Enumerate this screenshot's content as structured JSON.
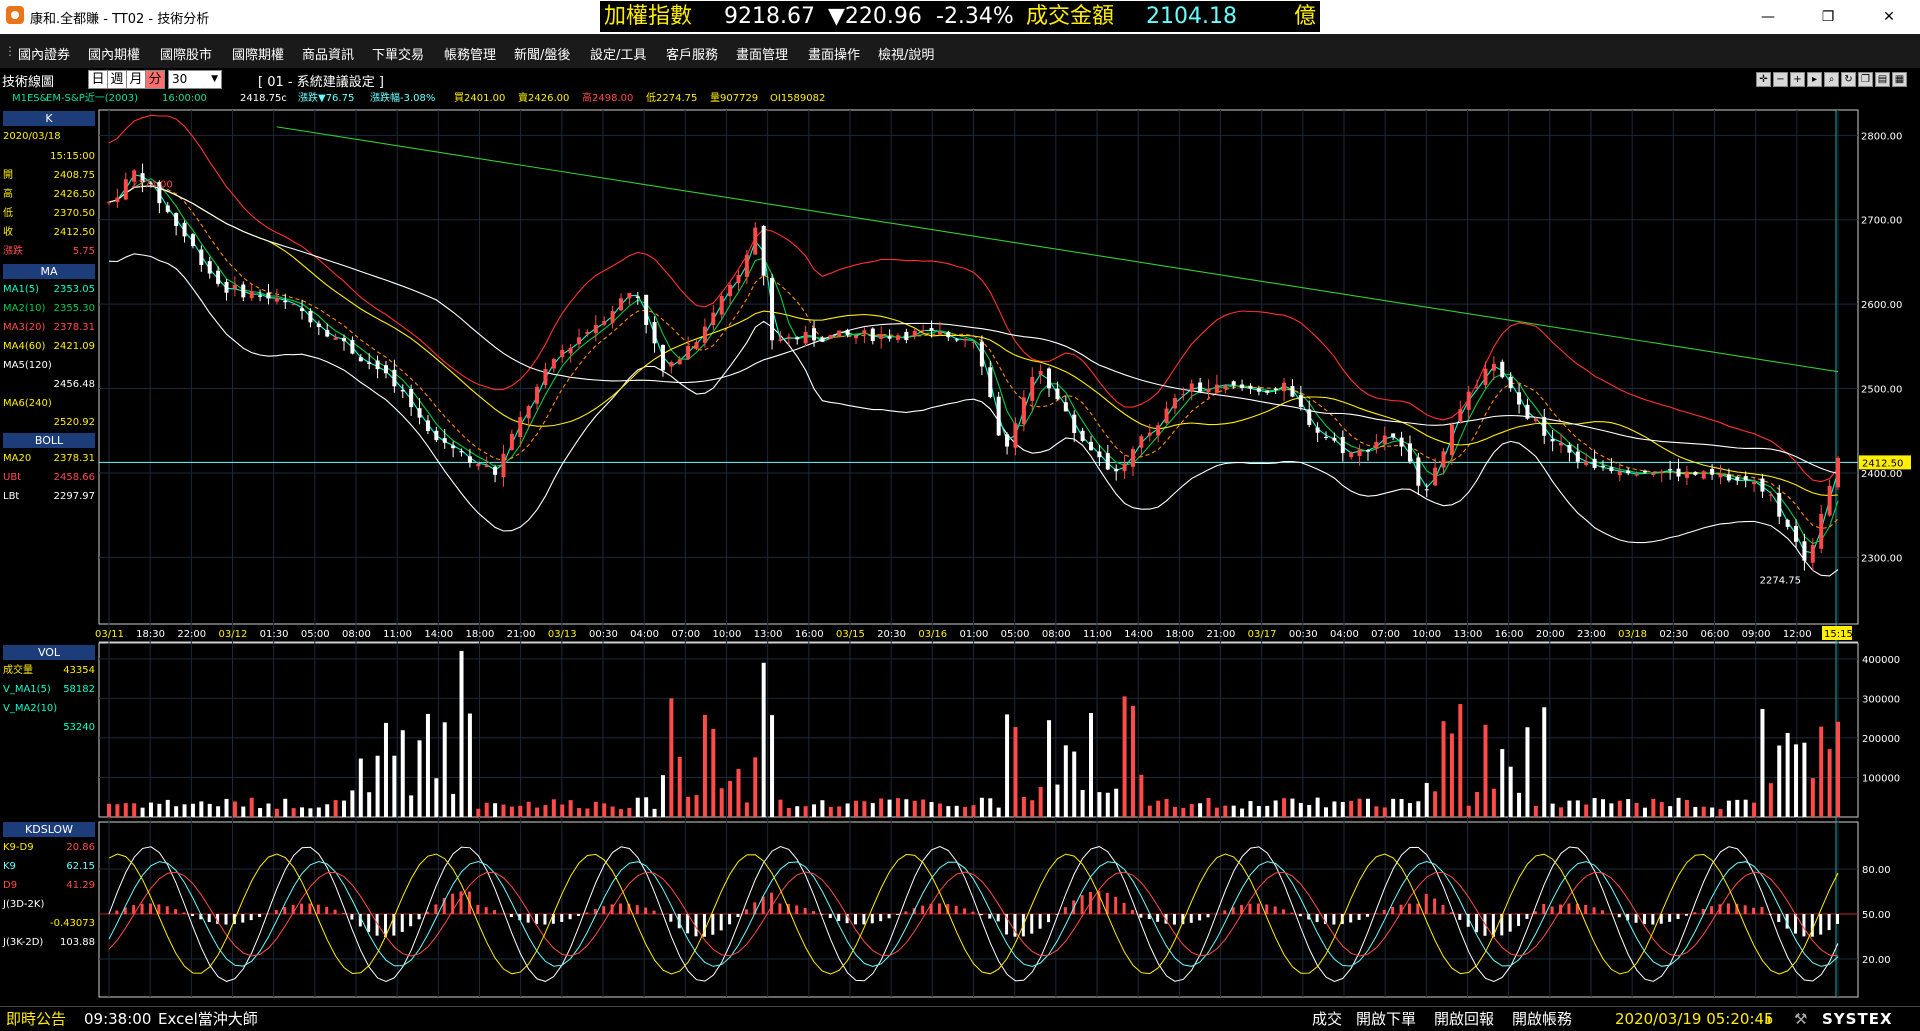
{
  "window": {
    "title": "康和.全都賺 - TT02 - 技術分析",
    "minimize_glyph": "—",
    "maximize_glyph": "❐",
    "close_glyph": "✕"
  },
  "ticker": {
    "index_label": "加權指數",
    "index_value": "9218.67",
    "change": "▼220.96",
    "change_pct": "-2.34%",
    "turnover_label": "成交金額",
    "turnover_value": "2104.18",
    "turnover_unit": "億"
  },
  "menu": {
    "items": [
      "國內證券",
      "國內期權",
      "國際股市",
      "國際期權",
      "商品資訊",
      "下單交易",
      "帳務管理",
      "新聞/盤後",
      "設定/工具",
      "客戶服務",
      "畫面管理",
      "畫面操作",
      "檢視/說明"
    ]
  },
  "toolbar": {
    "title": "技術線圖",
    "periods": [
      "日",
      "週",
      "月",
      "分"
    ],
    "selected_period": "分",
    "interval_value": "30",
    "system_setting": "[ 01 - 系統建議設定 ]"
  },
  "info": {
    "symbol": "M1ES&",
    "name": "EM-S&P近一(2003)",
    "time": "16:00:00",
    "price": "2418.75c",
    "change": "漲跌▼76.75",
    "change_pct": "漲跌幅-3.08%",
    "buy": "買2401.00",
    "sell": "賣2426.00",
    "high": "高2498.00",
    "low": "低2274.75",
    "volume": "量907729",
    "oi": "OI1589082"
  },
  "sidebar": {
    "k_head": "K",
    "date": "2020/03/18",
    "time": "15:15:00",
    "open_label": "開",
    "open_value": "2408.75",
    "high_label": "高",
    "high_value": "2426.50",
    "low_label": "低",
    "low_value": "2370.50",
    "close_label": "收",
    "close_value": "2412.50",
    "chg_label": "漲跌",
    "chg_value": "5.75",
    "ma_head": "MA",
    "ma1_label": "MA1(5)",
    "ma1_value": "2353.05",
    "ma2_label": "MA2(10)",
    "ma2_value": "2355.30",
    "ma3_label": "MA3(20)",
    "ma3_value": "2378.31",
    "ma4_label": "MA4(60)",
    "ma4_value": "2421.09",
    "ma5_label": "MA5(120)",
    "ma5_value": "2456.48",
    "ma6_label": "MA6(240)",
    "ma6_value": "2520.92",
    "boll_head": "BOLL",
    "bma_label": "MA20",
    "bma_value": "2378.31",
    "ubt_label": "UBt",
    "ubt_value": "2458.66",
    "lbt_label": "LBt",
    "lbt_value": "2297.97",
    "vol_head": "VOL",
    "vol_label": "成交量",
    "vol_value": "43354",
    "vma1_label": "V_MA1(5)",
    "vma1_value": "58182",
    "vma2_label": "V_MA2(10)",
    "vma2_value": "53240",
    "kd_head": "KDSLOW",
    "k9d9_label": "K9-D9",
    "k9d9_value": "20.86",
    "k9_label": "K9",
    "k9_value": "62.15",
    "d9_label": "D9",
    "d9_value": "41.29",
    "j3d_label": "J(3D-2K)",
    "j3d_value": "-0.43073",
    "j3k_label": "J(3K-2D)",
    "j3k_value": "103.88"
  },
  "axes": {
    "price_ticks": [
      "2800.00",
      "2700.00",
      "2600.00",
      "2500.00",
      "2400.00",
      "2300.00"
    ],
    "price_ticks_values": [
      2800,
      2700,
      2600,
      2500,
      2400,
      2300
    ],
    "price_marker": "2412.50",
    "high_label": "2774.00",
    "low_label": "2274.75",
    "vol_ticks": [
      "400000",
      "300000",
      "200000",
      "100000"
    ],
    "vol_ticks_values": [
      400000,
      300000,
      200000,
      100000
    ],
    "kd_ticks": [
      "80.00",
      "50.00",
      "20.00"
    ],
    "kd_ticks_values": [
      80,
      50,
      20
    ],
    "time_labels": [
      {
        "text": "03/11",
        "date": true
      },
      {
        "text": "18:30"
      },
      {
        "text": "22:00"
      },
      {
        "text": "03/12",
        "date": true
      },
      {
        "text": "01:30"
      },
      {
        "text": "05:00"
      },
      {
        "text": "08:00"
      },
      {
        "text": "11:00"
      },
      {
        "text": "14:00"
      },
      {
        "text": "18:00"
      },
      {
        "text": "21:00"
      },
      {
        "text": "03/13",
        "date": true
      },
      {
        "text": "00:30"
      },
      {
        "text": "04:00"
      },
      {
        "text": "07:00"
      },
      {
        "text": "10:00"
      },
      {
        "text": "13:00"
      },
      {
        "text": "16:00"
      },
      {
        "text": "03/15",
        "date": true
      },
      {
        "text": "20:30"
      },
      {
        "text": "03/16",
        "date": true
      },
      {
        "text": "01:00"
      },
      {
        "text": "05:00"
      },
      {
        "text": "08:00"
      },
      {
        "text": "11:00"
      },
      {
        "text": "14:00"
      },
      {
        "text": "18:00"
      },
      {
        "text": "21:00"
      },
      {
        "text": "03/17",
        "date": true
      },
      {
        "text": "00:30"
      },
      {
        "text": "04:00"
      },
      {
        "text": "07:00"
      },
      {
        "text": "10:00"
      },
      {
        "text": "13:00"
      },
      {
        "text": "16:00"
      },
      {
        "text": "20:00"
      },
      {
        "text": "23:00"
      },
      {
        "text": "03/18",
        "date": true
      },
      {
        "text": "02:30"
      },
      {
        "text": "06:00"
      },
      {
        "text": "09:00"
      },
      {
        "text": "12:00"
      },
      {
        "text": "15:15",
        "current": true
      }
    ]
  },
  "colors": {
    "up": "#ff4a4a",
    "down": "#ffffff",
    "ma1": "#00ffcc",
    "ma2": "#00cc44",
    "ma3": "#ff8c00",
    "ma4": "#ffee00",
    "ma5": "#ffffff",
    "ma6": "#33cc33",
    "boll_upper": "#ff3030",
    "boll_lower": "#ffffff",
    "panel_head": "#1c3d7a",
    "grid": "#1a2a3a",
    "date_label": "#ffee00"
  },
  "statusbar": {
    "left_label": "即時公告",
    "time": "09:38:00",
    "news": "Excel當沖大師",
    "btn_trade": "成交",
    "btn_order": "開啟下單",
    "btn_report": "開啟回報",
    "btn_account": "開啟帳務",
    "datetime": "2020/03/19 05:20:45",
    "brand": "SYSTEX"
  }
}
